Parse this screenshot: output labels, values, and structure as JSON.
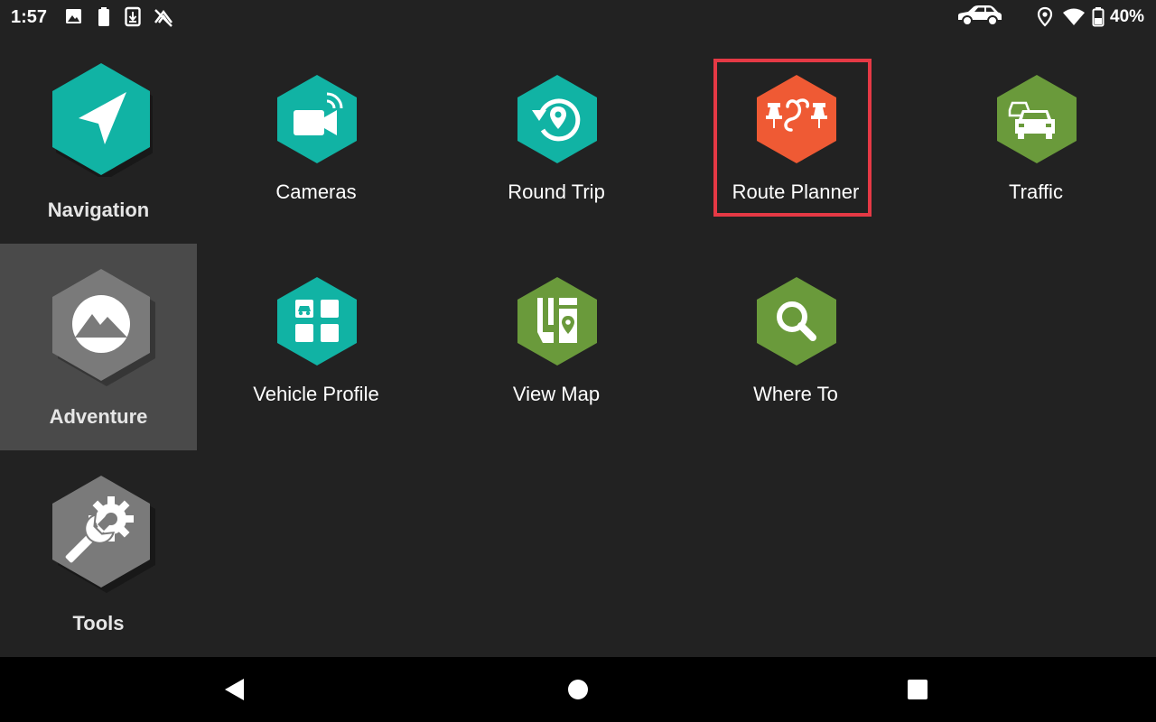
{
  "status_bar": {
    "time": "1:57",
    "battery": "40%",
    "icons": [
      "image-icon",
      "battery-icon",
      "download-icon",
      "no-signal-icon",
      "car-icon",
      "location-icon",
      "wifi-icon",
      "battery-icon"
    ]
  },
  "sidebar": {
    "items": [
      {
        "label": "Navigation",
        "color": "#11b3a4"
      },
      {
        "label": "Adventure",
        "color": "#7a7a7a"
      },
      {
        "label": "Tools",
        "color": "#7a7a7a"
      }
    ]
  },
  "apps": [
    {
      "label": "Cameras",
      "color": "#11b3a4",
      "icon": "camera-icon"
    },
    {
      "label": "Round Trip",
      "color": "#11b3a4",
      "icon": "round-trip-icon"
    },
    {
      "label": "Route Planner",
      "color": "#ef5a34",
      "icon": "route-planner-icon"
    },
    {
      "label": "Traffic",
      "color": "#6a9a3b",
      "icon": "traffic-icon"
    },
    {
      "label": "Vehicle Profile",
      "color": "#11b3a4",
      "icon": "vehicle-profile-icon"
    },
    {
      "label": "View Map",
      "color": "#6a9a3b",
      "icon": "map-icon"
    },
    {
      "label": "Where To",
      "color": "#6a9a3b",
      "icon": "search-icon"
    }
  ],
  "highlight_color": "#e53945",
  "nav_bar": {
    "buttons": [
      "back-icon",
      "home-icon",
      "recents-icon"
    ]
  }
}
